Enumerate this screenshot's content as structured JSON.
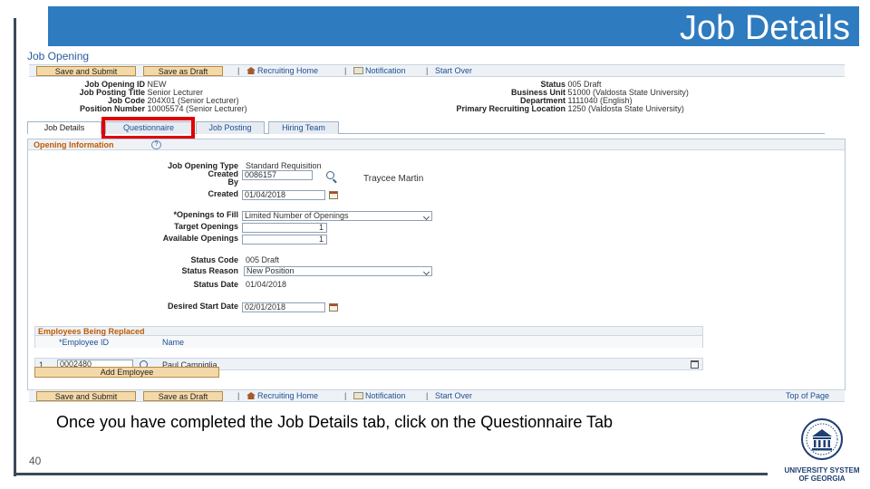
{
  "slide": {
    "title": "Job Details",
    "caption": "Once you have completed the Job Details tab, click on the Questionnaire Tab",
    "number": "40",
    "logo_line1": "UNIVERSITY SYSTEM",
    "logo_line2": "OF GEORGIA",
    "title_bar_color": "#2e7bbf",
    "highlight_color": "#e00000"
  },
  "app": {
    "page_title": "Job Opening",
    "toolbar": {
      "save_submit": "Save and Submit",
      "save_draft": "Save as Draft",
      "recruiting_home": "Recruiting Home",
      "notification": "Notification",
      "start_over": "Start Over",
      "top_of_page": "Top of Page",
      "separator": "|"
    },
    "header": {
      "job_opening_id_label": "Job Opening ID",
      "job_opening_id": "NEW",
      "job_posting_title_label": "Job Posting Title",
      "job_posting_title": "Senior Lecturer",
      "job_code_label": "Job Code",
      "job_code": "204X01 (Senior Lecturer)",
      "position_number_label": "Position Number",
      "position_number": "10005574 (Senior Lecturer)",
      "status_label": "Status",
      "status": "005 Draft",
      "business_unit_label": "Business Unit",
      "business_unit": "51000 (Valdosta State University)",
      "department_label": "Department",
      "department": "1111040 (English)",
      "primary_location_label": "Primary Recruiting Location",
      "primary_location": "1250 (Valdosta State University)"
    },
    "tabs": [
      {
        "label": "Job Details",
        "active": true
      },
      {
        "label": "Questionnaire",
        "active": false
      },
      {
        "label": "Job Posting",
        "active": false
      },
      {
        "label": "Hiring Team",
        "active": false
      }
    ],
    "opening_info": {
      "section_title": "Opening Information",
      "help": "?",
      "job_opening_type_label": "Job Opening Type",
      "job_opening_type": "Standard Requisition",
      "created_by_label_1": "Created",
      "created_by_label_2": "By",
      "created_by_id": "0086157",
      "created_by_name": "Traycee Martin",
      "created_label": "Created",
      "created_date": "01/04/2018",
      "openings_to_fill_label": "*Openings to Fill",
      "openings_to_fill": "Limited Number of Openings",
      "target_openings_label": "Target Openings",
      "target_openings": "1",
      "available_openings_label": "Available Openings",
      "available_openings": "1",
      "status_code_label": "Status Code",
      "status_code": "005 Draft",
      "status_reason_label": "Status Reason",
      "status_reason": "New Position",
      "status_date_label": "Status Date",
      "status_date": "01/04/2018",
      "desired_start_label": "Desired Start Date",
      "desired_start": "02/01/2018"
    },
    "employees": {
      "title": "Employees Being Replaced",
      "col_employee_id": "*Employee ID",
      "col_name": "Name",
      "rows": [
        {
          "num": "1",
          "employee_id": "0002480",
          "name": "Paul Campiglia"
        }
      ],
      "add_button": "Add Employee"
    }
  }
}
